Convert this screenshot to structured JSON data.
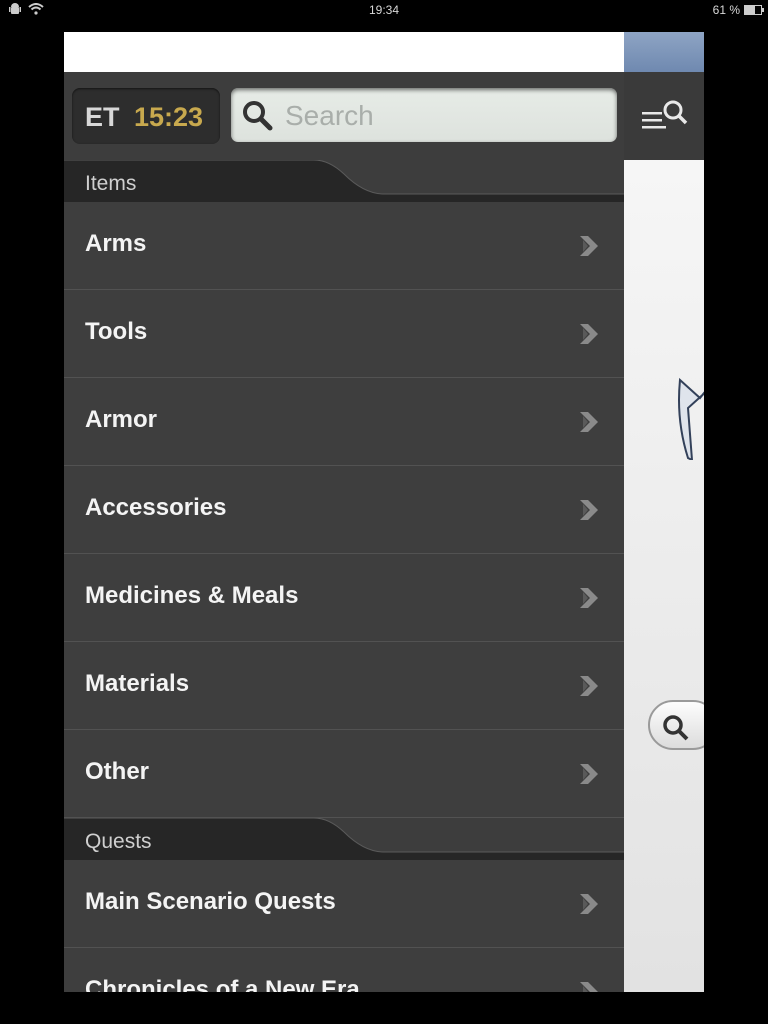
{
  "status_bar": {
    "time": "19:34",
    "battery_text": "61 %",
    "battery_level": 0.61,
    "left_icons": [
      "android-icon",
      "wifi-icon"
    ]
  },
  "header": {
    "et_label": "ET",
    "et_time": "15:23",
    "search_placeholder": "Search"
  },
  "sections": [
    {
      "title": "Items",
      "items": [
        "Arms",
        "Tools",
        "Armor",
        "Accessories",
        "Medicines & Meals",
        "Materials",
        "Other"
      ]
    },
    {
      "title": "Quests",
      "items": [
        "Main Scenario Quests",
        "Chronicles of a New Era"
      ]
    }
  ],
  "colors": {
    "panel_bg": "#3d3d3d",
    "et_time": "#c8a94e",
    "item_text": "#f4f4f4",
    "divider": "#525252"
  }
}
